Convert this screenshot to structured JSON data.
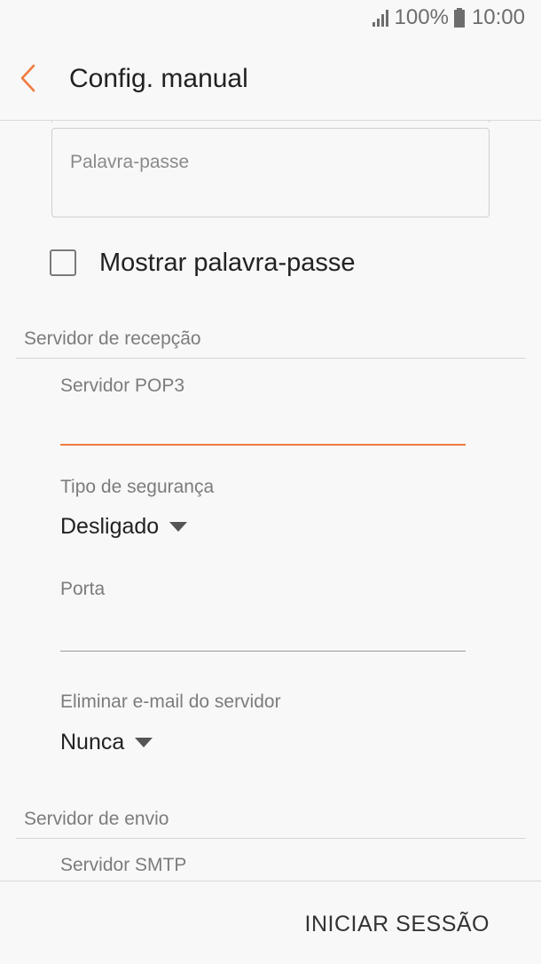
{
  "status_bar": {
    "battery_percent": "100%",
    "time": "10:00",
    "icons": [
      "signal-icon",
      "battery-icon"
    ]
  },
  "app_bar": {
    "title": "Config. manual",
    "back_icon": "chevron-left-icon",
    "accent_color": "#f07a3c"
  },
  "credentials": {
    "password_placeholder": "Palavra-passe",
    "show_password_label": "Mostrar palavra-passe",
    "show_password_checked": false
  },
  "incoming": {
    "header": "Servidor de recepção",
    "server_label": "Servidor POP3",
    "server_value": "",
    "security_label": "Tipo de segurança",
    "security_value": "Desligado",
    "port_label": "Porta",
    "port_value": "",
    "delete_label": "Eliminar e-mail do servidor",
    "delete_value": "Nunca"
  },
  "outgoing": {
    "header": "Servidor de envio",
    "server_label": "Servidor SMTP"
  },
  "footer": {
    "login_label": "INICIAR SESSÃO"
  }
}
